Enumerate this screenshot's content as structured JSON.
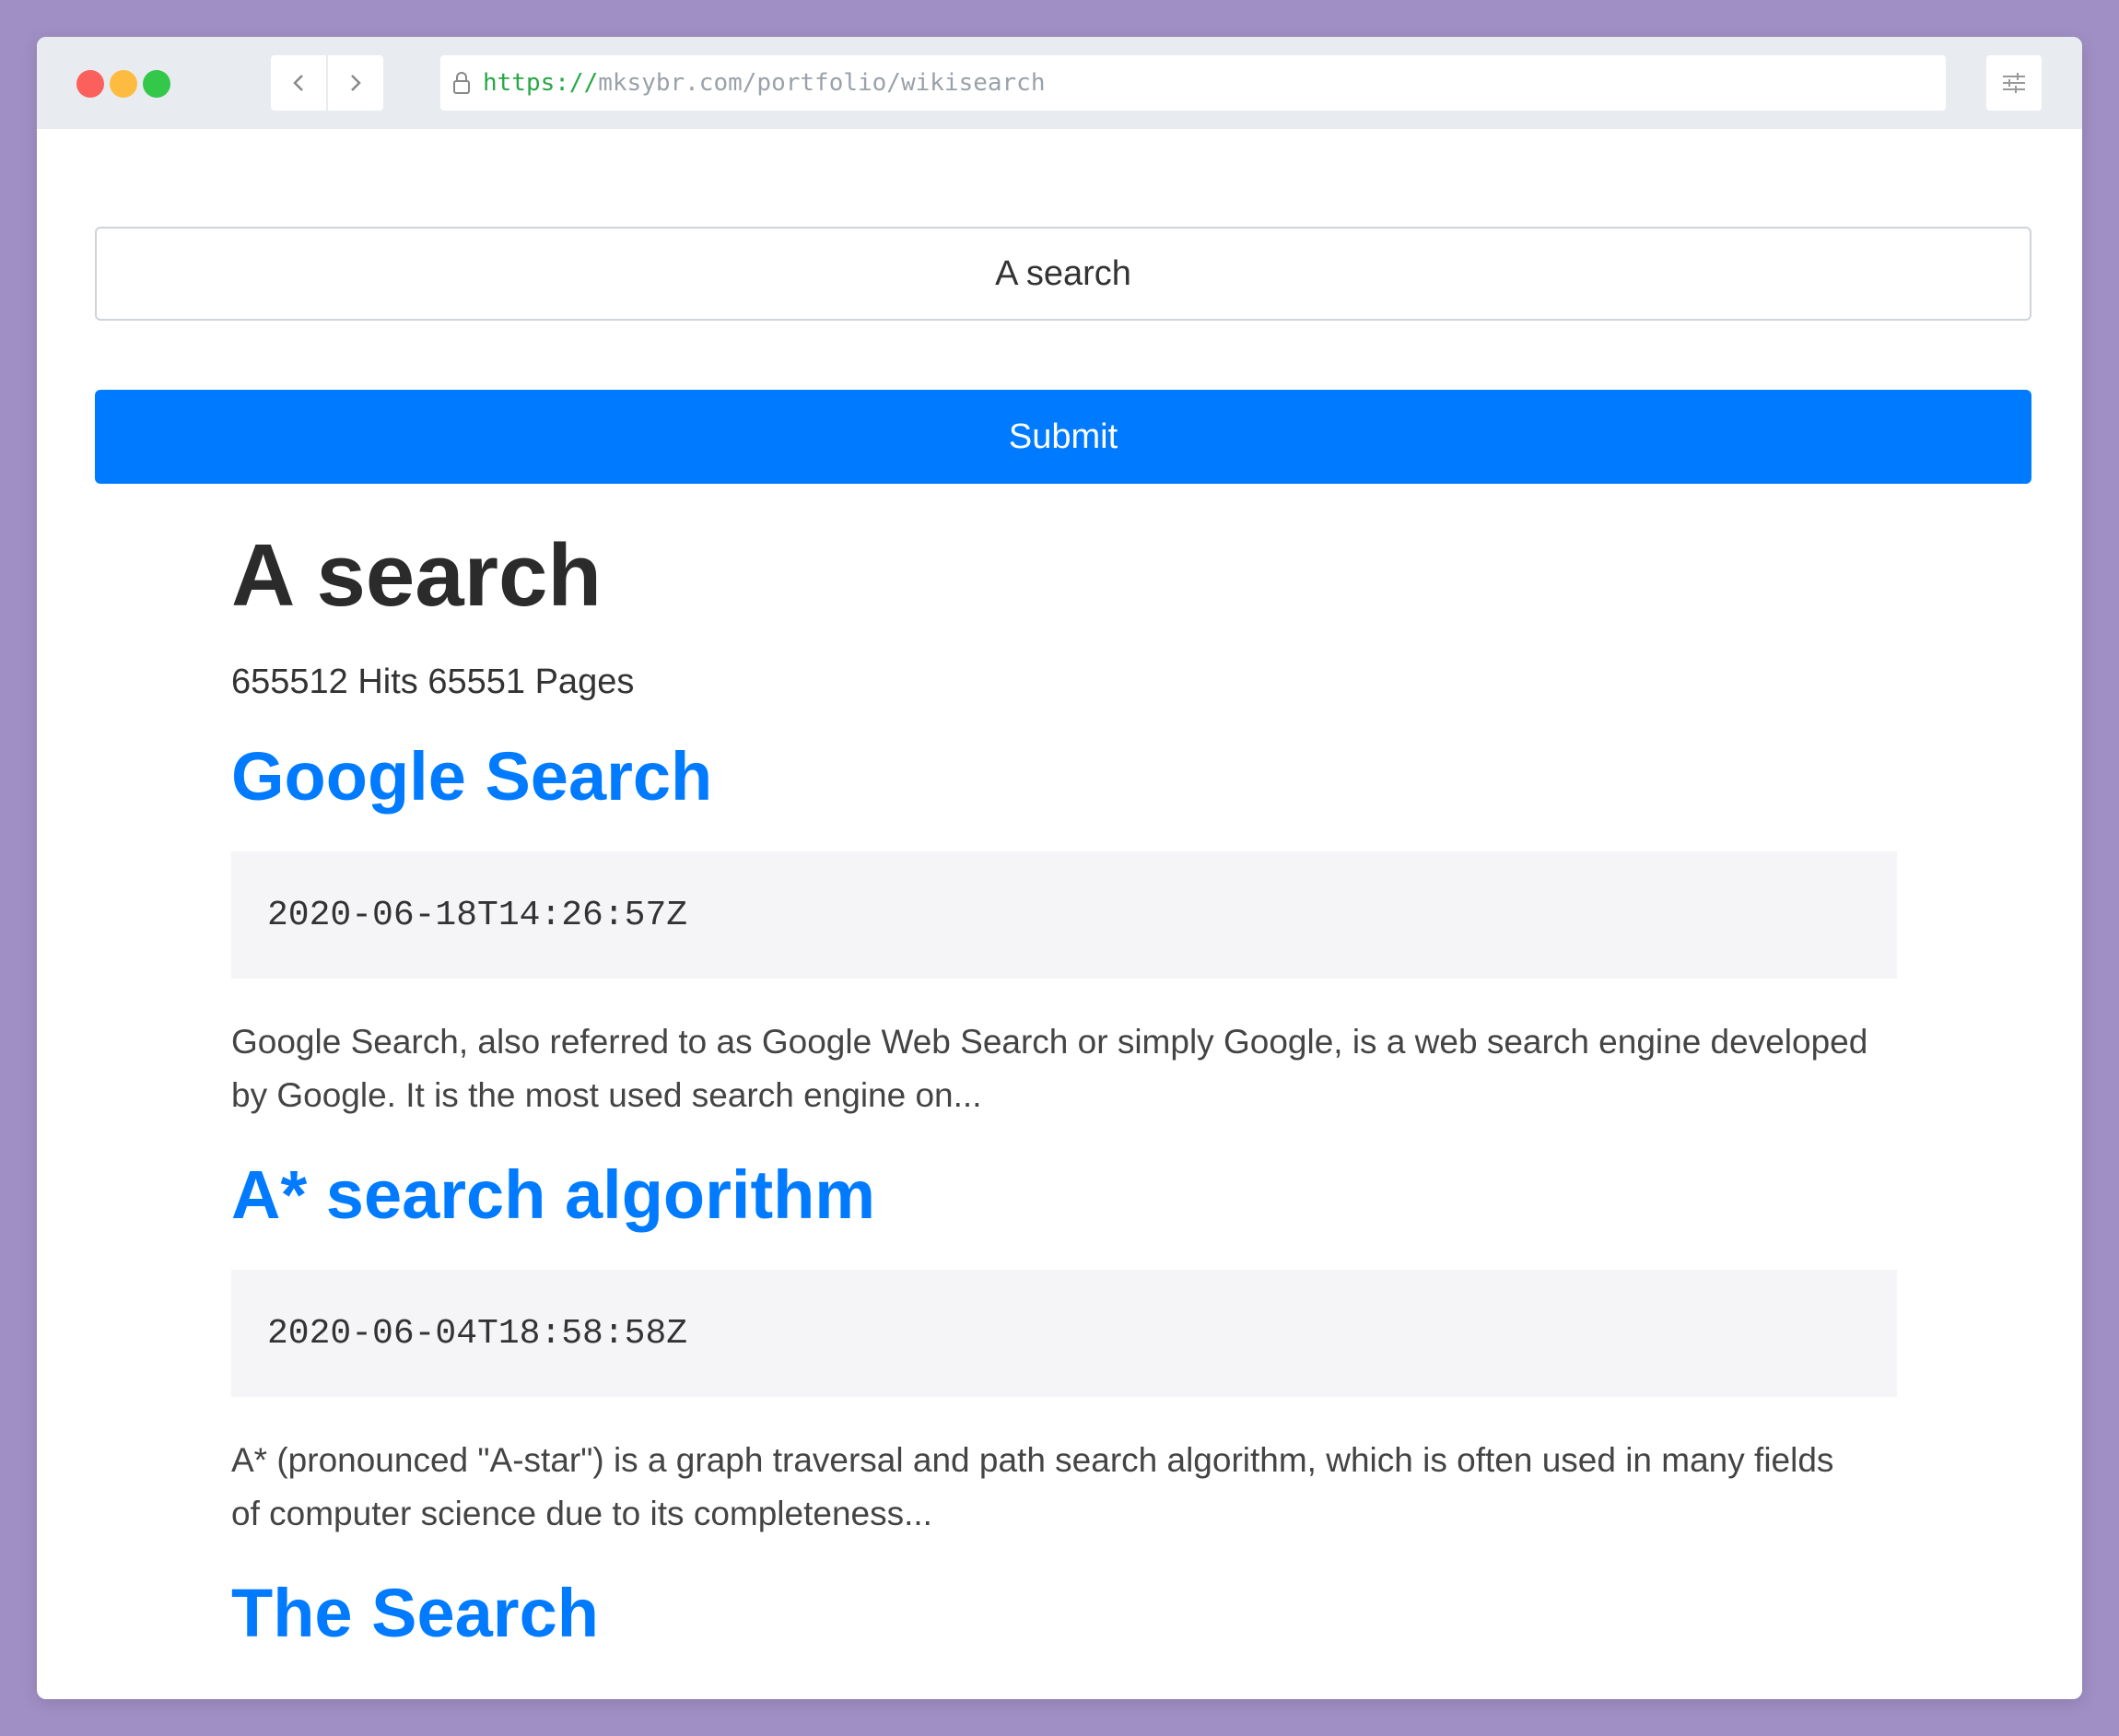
{
  "browser": {
    "url_scheme": "https://",
    "url_rest": "mksybr.com/portfolio/wikisearch"
  },
  "search": {
    "value": "A search",
    "submit_label": "Submit"
  },
  "results_header": {
    "title": "A search",
    "meta": "655512 Hits 65551 Pages"
  },
  "results": [
    {
      "title": "Google Search",
      "timestamp": "2020-06-18T14:26:57Z",
      "snippet": "Google Search, also referred to as Google Web Search or simply Google, is a web search engine developed by Google. It is the most used search engine on..."
    },
    {
      "title": "A* search algorithm",
      "timestamp": "2020-06-04T18:58:58Z",
      "snippet": "A* (pronounced \"A-star\") is a graph traversal and path search algorithm, which is often used in many fields of computer science due to its completeness..."
    },
    {
      "title": "The Search",
      "timestamp": "",
      "snippet": ""
    }
  ],
  "colors": {
    "accent": "#007bff",
    "background": "#a08fc4",
    "titlebar": "#e8ebef"
  },
  "icons": [
    "close-dot-icon",
    "minimize-dot-icon",
    "maximize-dot-icon",
    "chevron-left-icon",
    "chevron-right-icon",
    "lock-icon",
    "settings-sliders-icon"
  ]
}
